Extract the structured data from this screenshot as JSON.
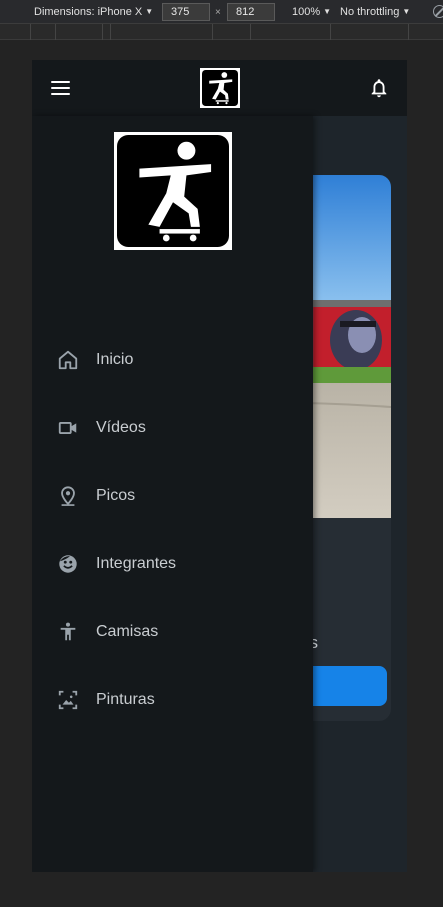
{
  "devtools": {
    "dimensions_label": "Dimensions: iPhone X",
    "width_value": "375",
    "height_value": "812",
    "times_sign": "×",
    "zoom": "100%",
    "throttling": "No throttling"
  },
  "header": {
    "menu_icon": "hamburger-menu-icon",
    "logo_icon": "skateboarder-logo",
    "notification_icon": "bell-icon"
  },
  "drawer": {
    "logo_icon": "skateboarder-logo",
    "items": [
      {
        "label": "Inicio",
        "icon": "home-icon"
      },
      {
        "label": "Vídeos",
        "icon": "video-camera-icon"
      },
      {
        "label": "Picos",
        "icon": "location-pin-icon"
      },
      {
        "label": "Integrantes",
        "icon": "face-icon"
      },
      {
        "label": "Camisas",
        "icon": "person-standing-icon"
      },
      {
        "label": "Pinturas",
        "icon": "image-frame-icon"
      }
    ]
  },
  "background": {
    "partial_text": "es"
  },
  "colors": {
    "page_background": "#232323",
    "app_header": "#14181b",
    "drawer_background": "#14181b",
    "content_background": "#1e252b",
    "card_background": "#262d34",
    "accent_button": "#1683e8",
    "nav_text": "#c9cdd1",
    "nav_icon": "#9aa3ab"
  }
}
